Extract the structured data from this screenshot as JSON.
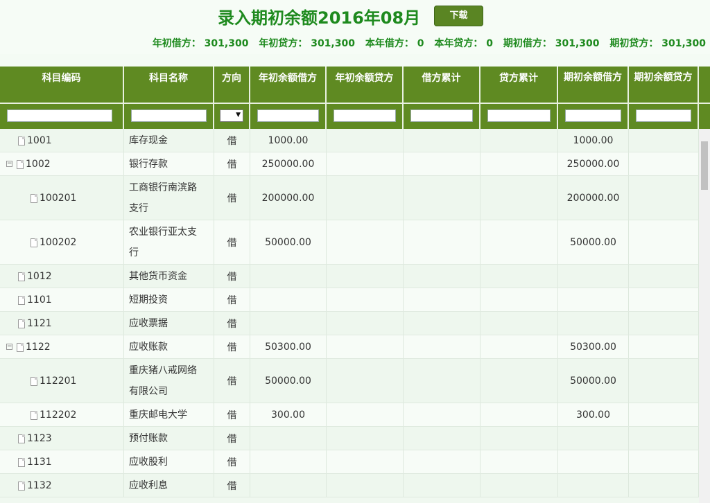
{
  "header": {
    "title": "录入期初余额2016年08月",
    "download_label": "下载"
  },
  "summary": {
    "year_debit": "年初借方： 301,300",
    "year_credit": "年初贷方： 301,300",
    "current_debit": "本年借方： 0",
    "current_credit": "本年贷方： 0",
    "period_debit": "期初借方： 301,300",
    "period_credit": "期初贷方： 301,300"
  },
  "columns": [
    "科目编码",
    "科目名称",
    "方向",
    "年初余额借方",
    "年初余额贷方",
    "借方累计",
    "贷方累计",
    "期初余额借方",
    "期初余额贷方"
  ],
  "rows": [
    {
      "code": "1001",
      "name": "库存现金",
      "dir": "借",
      "yd": "1000.00",
      "yc": "",
      "db": "",
      "cr": "",
      "pd": "1000.00",
      "pc": ""
    },
    {
      "code": "1002",
      "name": "银行存款",
      "dir": "借",
      "yd": "250000.00",
      "yc": "",
      "db": "",
      "cr": "",
      "pd": "250000.00",
      "pc": ""
    },
    {
      "code": "100201",
      "name": "工商银行南滨路支行",
      "dir": "借",
      "yd": "200000.00",
      "yc": "",
      "db": "",
      "cr": "",
      "pd": "200000.00",
      "pc": ""
    },
    {
      "code": "100202",
      "name": "农业银行亚太支行",
      "dir": "借",
      "yd": "50000.00",
      "yc": "",
      "db": "",
      "cr": "",
      "pd": "50000.00",
      "pc": ""
    },
    {
      "code": "1012",
      "name": "其他货币资金",
      "dir": "借",
      "yd": "",
      "yc": "",
      "db": "",
      "cr": "",
      "pd": "",
      "pc": ""
    },
    {
      "code": "1101",
      "name": "短期投资",
      "dir": "借",
      "yd": "",
      "yc": "",
      "db": "",
      "cr": "",
      "pd": "",
      "pc": ""
    },
    {
      "code": "1121",
      "name": "应收票据",
      "dir": "借",
      "yd": "",
      "yc": "",
      "db": "",
      "cr": "",
      "pd": "",
      "pc": ""
    },
    {
      "code": "1122",
      "name": "应收账款",
      "dir": "借",
      "yd": "50300.00",
      "yc": "",
      "db": "",
      "cr": "",
      "pd": "50300.00",
      "pc": ""
    },
    {
      "code": "112201",
      "name": "重庆猪八戒网络有限公司",
      "dir": "借",
      "yd": "50000.00",
      "yc": "",
      "db": "",
      "cr": "",
      "pd": "50000.00",
      "pc": ""
    },
    {
      "code": "112202",
      "name": "重庆邮电大学",
      "dir": "借",
      "yd": "300.00",
      "yc": "",
      "db": "",
      "cr": "",
      "pd": "300.00",
      "pc": ""
    },
    {
      "code": "1123",
      "name": "预付账款",
      "dir": "借",
      "yd": "",
      "yc": "",
      "db": "",
      "cr": "",
      "pd": "",
      "pc": ""
    },
    {
      "code": "1131",
      "name": "应收股利",
      "dir": "借",
      "yd": "",
      "yc": "",
      "db": "",
      "cr": "",
      "pd": "",
      "pc": ""
    },
    {
      "code": "1132",
      "name": "应收利息",
      "dir": "借",
      "yd": "",
      "yc": "",
      "db": "",
      "cr": "",
      "pd": "",
      "pc": ""
    }
  ]
}
